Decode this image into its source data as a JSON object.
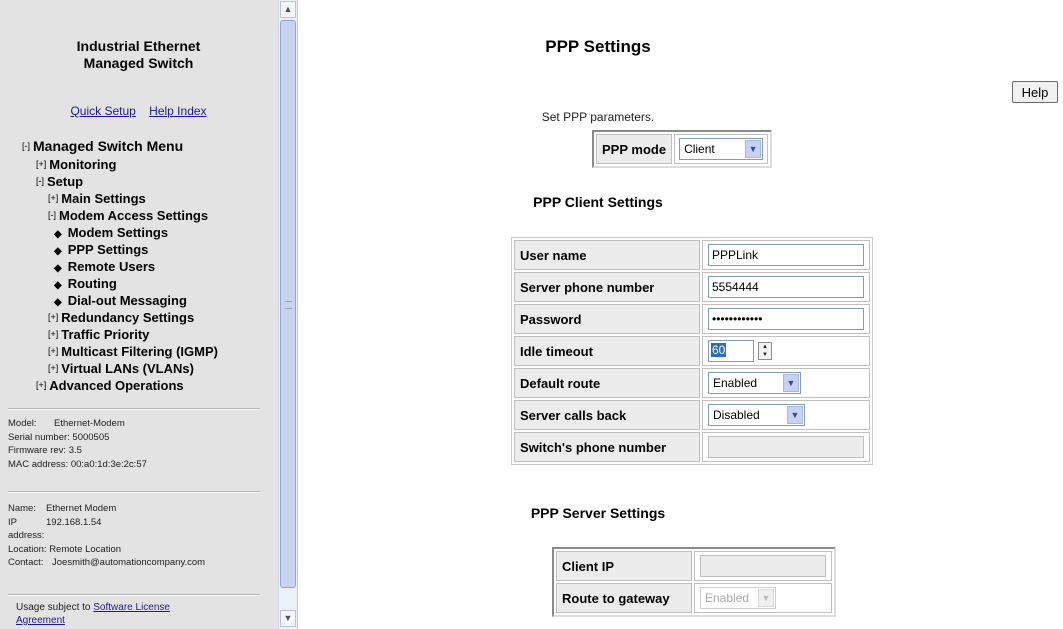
{
  "sidebar": {
    "product_title_line1": "Industrial Ethernet",
    "product_title_line2": "Managed Switch",
    "quick_setup": "Quick Setup",
    "help_index": "Help Index",
    "menu": [
      {
        "toggle": "[-]",
        "label": "Managed Switch Menu"
      },
      {
        "toggle": "[+]",
        "label": "Monitoring"
      },
      {
        "toggle": "[-]",
        "label": "Setup"
      },
      {
        "toggle": "[+]",
        "label": "Main Settings"
      },
      {
        "toggle": "[-]",
        "label": "Modem Access Settings"
      },
      {
        "bullet": "◆",
        "label": "Modem Settings"
      },
      {
        "bullet": "◆",
        "label": "PPP Settings"
      },
      {
        "bullet": "◆",
        "label": "Remote Users"
      },
      {
        "bullet": "◆",
        "label": "Routing"
      },
      {
        "bullet": "◆",
        "label": "Dial-out Messaging"
      },
      {
        "toggle": "[+]",
        "label": "Redundancy Settings"
      },
      {
        "toggle": "[+]",
        "label": "Traffic Priority"
      },
      {
        "toggle": "[+]",
        "label": "Multicast Filtering (IGMP)"
      },
      {
        "toggle": "[+]",
        "label": "Virtual LANs (VLANs)"
      },
      {
        "toggle": "[+]",
        "label": "Advanced Operations"
      }
    ],
    "device": {
      "model_label": "Model:",
      "model_value": "Ethernet-Modem",
      "serial": "Serial number: 5000505",
      "firmware": "Firmware rev: 3.5",
      "mac": "MAC address: 00:a0:1d:3e:2c:57"
    },
    "location": {
      "name_label": "Name:",
      "name_value": "Ethernet Modem",
      "ip_label_1": "IP",
      "ip_label_2": "address:",
      "ip_value": "192.168.1.54",
      "location": "Location: Remote Location",
      "contact_label": "Contact:",
      "contact_value": "Joesmith@automationcompany.com"
    },
    "usage_prefix": "Usage subject to ",
    "usage_link": "Software License",
    "usage_link_2": "Agreement"
  },
  "scrollbar": {
    "up_icon": "up-arrow-icon",
    "down_icon": "down-arrow-icon"
  },
  "main": {
    "title": "PPP Settings",
    "help_label": "Help",
    "subtitle": "Set PPP parameters.",
    "mode": {
      "label": "PPP mode",
      "value": "Client"
    },
    "client_title": "PPP Client Settings",
    "client": {
      "user_name_label": "User name",
      "user_name_value": "PPPLink",
      "server_phone_label": "Server phone number",
      "server_phone_value": "5554444",
      "password_label": "Password",
      "password_value": "************",
      "idle_label": "Idle timeout",
      "idle_value": "60",
      "default_route_label": "Default route",
      "default_route_value": "Enabled",
      "callback_label": "Server calls back",
      "callback_value": "Disabled",
      "switch_phone_label": "Switch's phone number",
      "switch_phone_value": ""
    },
    "server_title": "PPP Server Settings",
    "server": {
      "client_ip_label": "Client IP",
      "client_ip_value": "",
      "gateway_label": "Route to gateway",
      "gateway_value": "Enabled"
    }
  },
  "colors": {
    "sidebar_bg": "#e3e3e3",
    "link": "#1a1aa6",
    "label_cell_bg": "#ececec",
    "selection_highlight": "#316ac5"
  }
}
